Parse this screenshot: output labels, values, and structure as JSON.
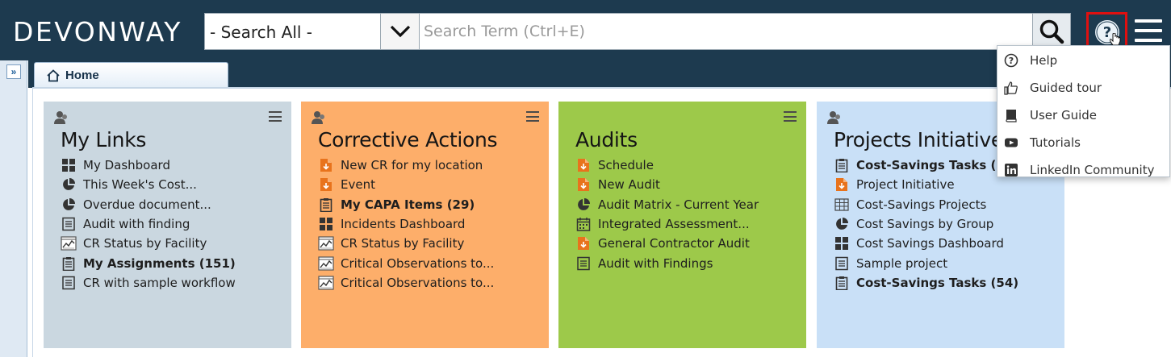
{
  "header": {
    "logo": "DEVONWAY",
    "search_scope": "- Search All -",
    "search_placeholder": "Search Term (Ctrl+E)"
  },
  "tabs": [
    {
      "label": "Home",
      "icon": "home-icon"
    }
  ],
  "cards": [
    {
      "title": "My Links",
      "color": "#cad7e0",
      "items": [
        {
          "label": "My Dashboard",
          "icon": "dashboard-icon",
          "bold": false
        },
        {
          "label": "This Week's Cost...",
          "icon": "pie-chart-icon",
          "bold": false
        },
        {
          "label": "Overdue document...",
          "icon": "pie-chart-icon",
          "bold": false
        },
        {
          "label": "Audit with finding",
          "icon": "list-icon",
          "bold": false
        },
        {
          "label": "CR Status by Facility",
          "icon": "report-chart-icon",
          "bold": false
        },
        {
          "label": "My Assignments (151)",
          "icon": "clipboard-icon",
          "bold": true
        },
        {
          "label": "CR with sample workflow",
          "icon": "list-icon",
          "bold": false
        }
      ]
    },
    {
      "title": "Corrective Actions",
      "color": "#fdae6a",
      "items": [
        {
          "label": "New CR for my location",
          "icon": "form-icon",
          "bold": false
        },
        {
          "label": "Event",
          "icon": "form-icon",
          "bold": false
        },
        {
          "label": "My CAPA Items (29)",
          "icon": "clipboard-icon",
          "bold": true
        },
        {
          "label": "Incidents Dashboard",
          "icon": "dashboard-icon",
          "bold": false
        },
        {
          "label": "CR Status by Facility",
          "icon": "report-chart-icon",
          "bold": false
        },
        {
          "label": "Critical Observations to...",
          "icon": "report-chart-icon",
          "bold": false
        },
        {
          "label": "Critical Observations to...",
          "icon": "report-chart-icon",
          "bold": false
        }
      ]
    },
    {
      "title": "Audits",
      "color": "#9dc94a",
      "items": [
        {
          "label": "Schedule",
          "icon": "form-icon",
          "bold": false
        },
        {
          "label": "New Audit",
          "icon": "form-icon",
          "bold": false
        },
        {
          "label": "Audit Matrix - Current Year",
          "icon": "pie-chart-icon",
          "bold": false
        },
        {
          "label": "Integrated Assessment...",
          "icon": "calendar-icon",
          "bold": false
        },
        {
          "label": "General Contractor Audit",
          "icon": "form-icon",
          "bold": false
        },
        {
          "label": "Audit with Findings",
          "icon": "list-icon",
          "bold": false
        }
      ]
    },
    {
      "title": "Projects Initiatives",
      "color": "#c9e0f7",
      "items": [
        {
          "label": "Cost-Savings Tasks (54)",
          "icon": "clipboard-icon",
          "bold": true
        },
        {
          "label": "Project Initiative",
          "icon": "form-icon",
          "bold": false
        },
        {
          "label": "Cost-Savings Projects",
          "icon": "table-icon",
          "bold": false
        },
        {
          "label": "Cost Savings by Group",
          "icon": "pie-chart-icon",
          "bold": false
        },
        {
          "label": "Cost Savings Dashboard",
          "icon": "dashboard-icon",
          "bold": false
        },
        {
          "label": "Sample project",
          "icon": "list-icon",
          "bold": false
        },
        {
          "label": "Cost-Savings Tasks (54)",
          "icon": "clipboard-icon",
          "bold": true
        }
      ]
    }
  ],
  "help_menu": [
    {
      "label": "Help",
      "icon": "question-circle-icon"
    },
    {
      "label": "Guided tour",
      "icon": "thumbs-up-icon"
    },
    {
      "label": "User Guide",
      "icon": "book-icon"
    },
    {
      "label": "Tutorials",
      "icon": "youtube-icon"
    },
    {
      "label": "LinkedIn Community",
      "icon": "linkedin-icon"
    }
  ]
}
